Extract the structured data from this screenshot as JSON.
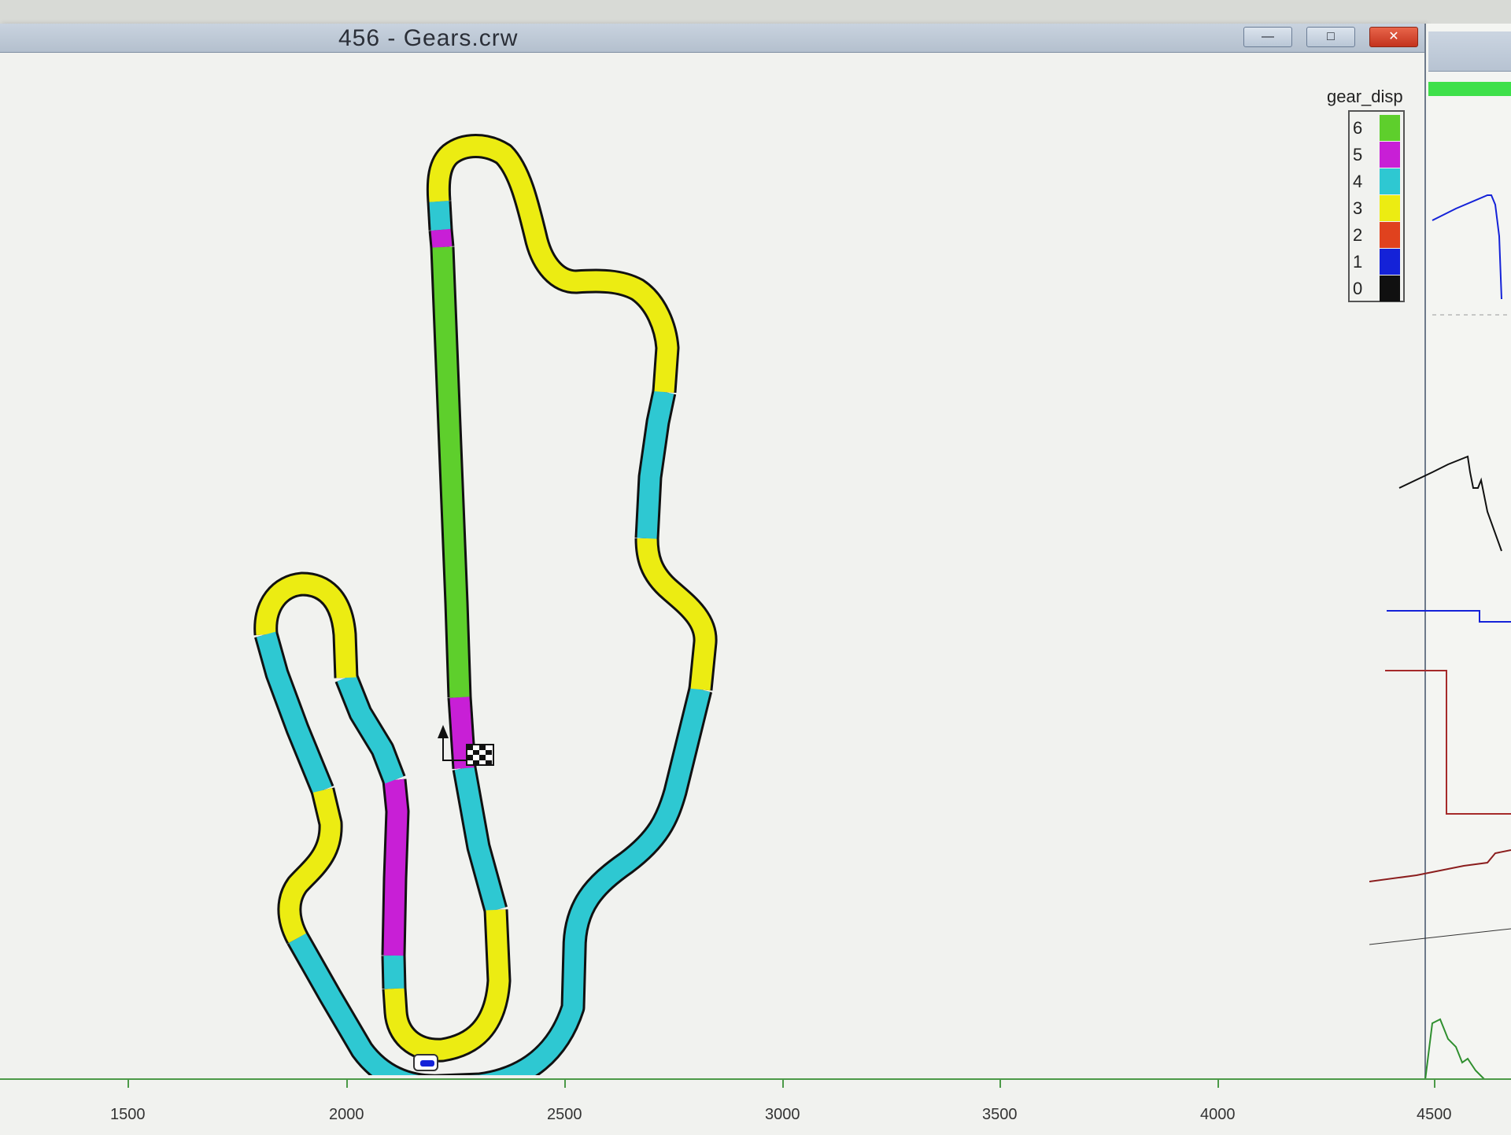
{
  "window": {
    "title": "456 - Gears.crw"
  },
  "window_controls": {
    "minimize": "—",
    "maximize": "□",
    "close": "✕"
  },
  "colors": {
    "gear_6": "#5ecf2c",
    "gear_5": "#c81fd6",
    "gear_4": "#2ec8d2",
    "gear_3": "#ecec12",
    "gear_2": "#e0421e",
    "gear_1": "#1422d8",
    "gear_0": "#101010",
    "track_outline": "#111111"
  },
  "legend": {
    "title": "gear_disp",
    "items": [
      {
        "label": "6",
        "color": "#5ecf2c"
      },
      {
        "label": "5",
        "color": "#c81fd6"
      },
      {
        "label": "4",
        "color": "#2ec8d2"
      },
      {
        "label": "3",
        "color": "#ecec12"
      },
      {
        "label": "2",
        "color": "#e0421e"
      },
      {
        "label": "1",
        "color": "#1422d8"
      },
      {
        "label": "0",
        "color": "#101010"
      }
    ]
  },
  "track": {
    "icons": {
      "start_finish": "checkered-flag-icon",
      "direction": "direction-arrow-icon",
      "car_marker": "car-position-icon"
    }
  },
  "x_axis": {
    "ticks": [
      "1500",
      "2000",
      "2500",
      "3000",
      "3500",
      "4000",
      "4500"
    ]
  }
}
